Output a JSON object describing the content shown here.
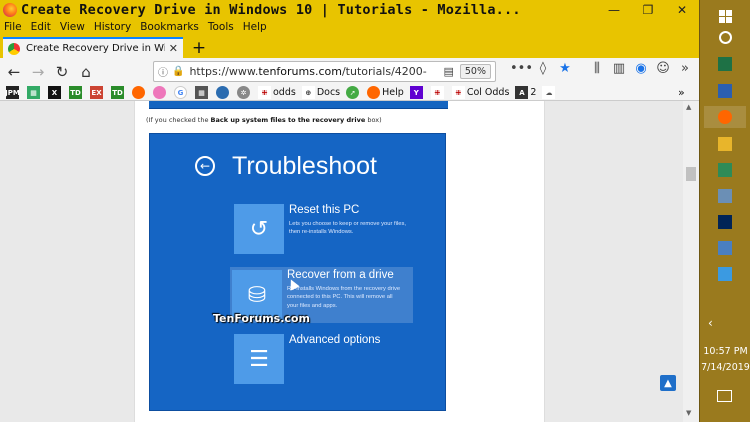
{
  "window": {
    "title": "Create Recovery Drive in Windows 10 | Tutorials - Mozilla...",
    "minimize": "—",
    "maximize": "❐",
    "close": "✕"
  },
  "menu": [
    "File",
    "Edit",
    "View",
    "History",
    "Bookmarks",
    "Tools",
    "Help"
  ],
  "tab": {
    "label": "Create Recovery Drive in Windo",
    "close": "✕",
    "new": "+"
  },
  "nav": {
    "url_scheme": "https://www.",
    "url_host": "tenforums.com",
    "url_path": "/tutorials/4200-",
    "zoom": "50%",
    "more": "•••"
  },
  "bookmarks": [
    {
      "icon": "JPM",
      "label": ""
    },
    {
      "icon": "X",
      "label": ""
    },
    {
      "icon": "TD",
      "label": ""
    },
    {
      "icon": "EX",
      "label": ""
    },
    {
      "icon": "TD",
      "label": ""
    },
    {
      "icon": "G",
      "label": ""
    },
    {
      "icon": "odds-icon",
      "label": "odds"
    },
    {
      "icon": "globe-icon",
      "label": "Docs"
    },
    {
      "icon": "firefox-icon",
      "label": "Help"
    },
    {
      "icon": "Y",
      "label": ""
    },
    {
      "icon": "col-icon",
      "label": "Col Odds"
    },
    {
      "icon": "A",
      "label": "2"
    }
  ],
  "article": {
    "caption_pre": "(If you checked the ",
    "caption_bold": "Back up system files to the recovery drive",
    "caption_post": " box)",
    "screen": {
      "title": "Troubleshoot",
      "options": [
        {
          "title": "Reset this PC",
          "desc": "Lets you choose to keep or remove your files, then re-installs Windows."
        },
        {
          "title": "Recover from a drive",
          "desc": "Re-installs Windows from the recovery drive connected to this PC. This will remove all your files and apps."
        },
        {
          "title": "Advanced options",
          "desc": ""
        }
      ],
      "watermark": "TenForums.com"
    }
  },
  "taskbar": {
    "time": "10:57 PM",
    "date": "7/14/2019"
  }
}
